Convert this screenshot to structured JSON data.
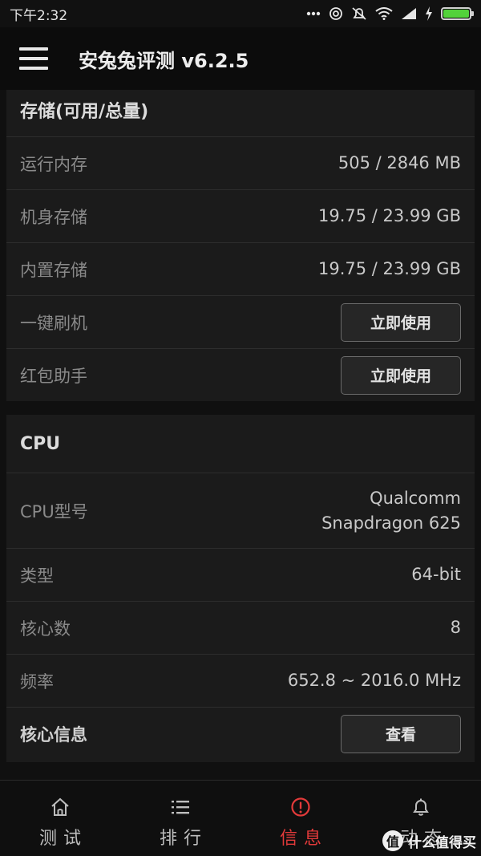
{
  "status_bar": {
    "time": "下午2:32",
    "icons": [
      "more-dots-icon",
      "hotspot-icon",
      "alarm-off-icon",
      "wifi-icon",
      "signal-icon",
      "charging-icon",
      "battery-icon"
    ],
    "battery_color": "#52d23a"
  },
  "app_bar": {
    "title": "安兔兔评测 v6.2.5",
    "menu_icon": "menu-icon"
  },
  "storage": {
    "title": "存储(可用/总量)",
    "rows": [
      {
        "label": "运行内存",
        "value": "505 / 2846 MB"
      },
      {
        "label": "机身存储",
        "value": "19.75 / 23.99 GB"
      },
      {
        "label": "内置存储",
        "value": "19.75 / 23.99 GB"
      }
    ],
    "actions": [
      {
        "label": "一键刷机",
        "button": "立即使用"
      },
      {
        "label": "红包助手",
        "button": "立即使用"
      }
    ]
  },
  "cpu": {
    "title": "CPU",
    "model_label": "CPU型号",
    "model_line1": "Qualcomm",
    "model_line2": "Snapdragon 625",
    "rows": [
      {
        "label": "类型",
        "value": "64-bit"
      },
      {
        "label": "核心数",
        "value": "8"
      },
      {
        "label": "频率",
        "value": "652.8 ~ 2016.0 MHz"
      }
    ],
    "core_info": {
      "label": "核心信息",
      "button": "查看"
    }
  },
  "tabs": [
    {
      "label": "测试",
      "icon": "home-icon",
      "active": false
    },
    {
      "label": "排行",
      "icon": "list-icon",
      "active": false
    },
    {
      "label": "信息",
      "icon": "info-alert-icon",
      "active": true
    },
    {
      "label": "动态",
      "icon": "bell-icon",
      "active": false
    }
  ],
  "accent_color": "#e23a3a",
  "watermark": {
    "badge": "值",
    "text": "什么值得买"
  }
}
